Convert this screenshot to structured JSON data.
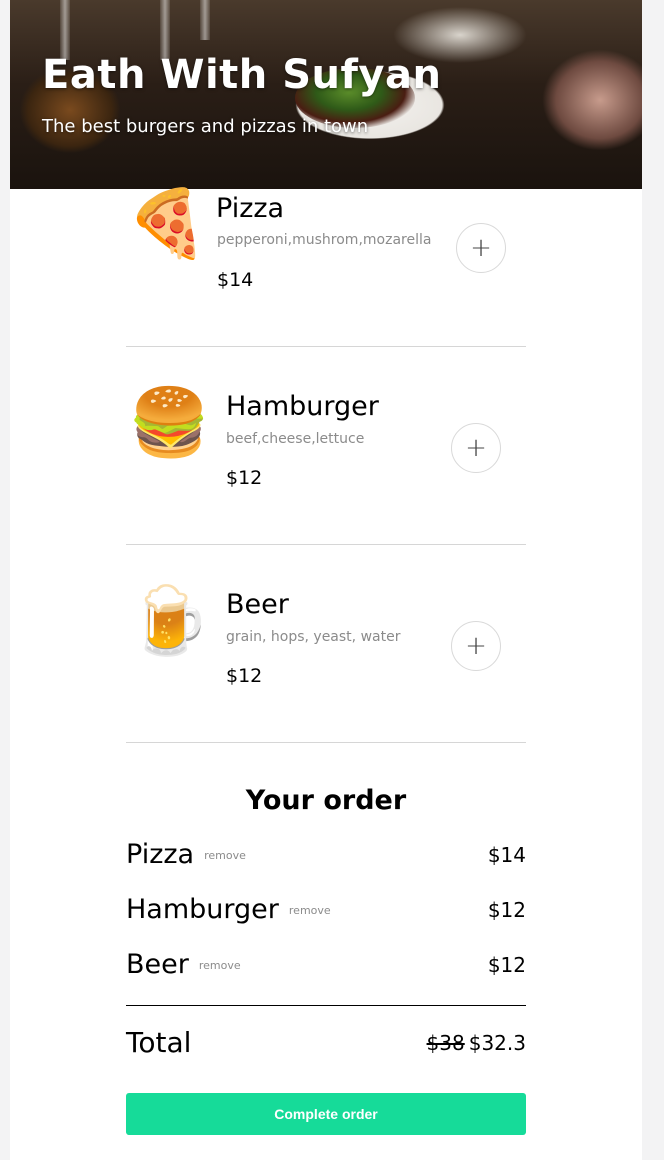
{
  "hero": {
    "title": "Eath With Sufyan",
    "subtitle": "The best burgers and pizzas in town"
  },
  "menu": {
    "items": [
      {
        "emoji": "🍕",
        "icon": "pizza-icon",
        "name": "Pizza",
        "ingredients": "pepperoni,mushrom,mozarella",
        "price": "$14",
        "add_label": "+"
      },
      {
        "emoji": "🍔",
        "icon": "hamburger-icon",
        "name": "Hamburger",
        "ingredients": "beef,cheese,lettuce",
        "price": "$12",
        "add_label": "+"
      },
      {
        "emoji": "🍺",
        "icon": "beer-icon",
        "name": "Beer",
        "ingredients": "grain, hops, yeast, water",
        "price": "$12",
        "add_label": "+"
      }
    ]
  },
  "order": {
    "title": "Your order",
    "remove_label": "remove",
    "items": [
      {
        "name": "Pizza",
        "price": "$14"
      },
      {
        "name": "Hamburger",
        "price": "$12"
      },
      {
        "name": "Beer",
        "price": "$12"
      }
    ],
    "total_label": "Total",
    "total_original": "$38",
    "total_discounted": "$32.3",
    "complete_label": "Complete order"
  },
  "colors": {
    "accent": "#16db99",
    "muted_text": "#8b8b8b",
    "divider": "#d6d6d6"
  }
}
